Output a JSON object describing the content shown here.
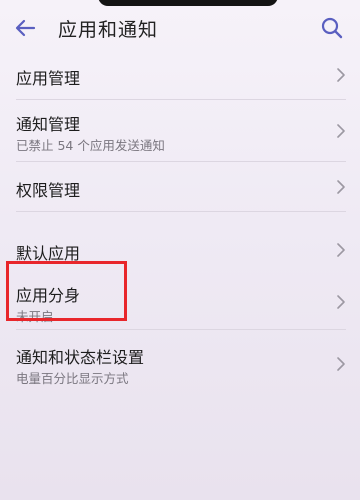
{
  "header": {
    "title": "应用和通知",
    "back_icon": "back-arrow-icon",
    "search_icon": "search-icon",
    "accent_color": "#5a5fc0"
  },
  "settings": {
    "items": [
      {
        "title": "应用管理",
        "subtitle": ""
      },
      {
        "title": "通知管理",
        "subtitle": "已禁止 54 个应用发送通知"
      },
      {
        "title": "权限管理",
        "subtitle": ""
      },
      {
        "title": "默认应用",
        "subtitle": ""
      },
      {
        "title": "应用分身",
        "subtitle": "未开启"
      },
      {
        "title": "通知和状态栏设置",
        "subtitle": "电量百分比显示方式"
      }
    ],
    "chevron_icon": "chevron-right-icon"
  },
  "highlight": {
    "color": "#e8262b"
  }
}
